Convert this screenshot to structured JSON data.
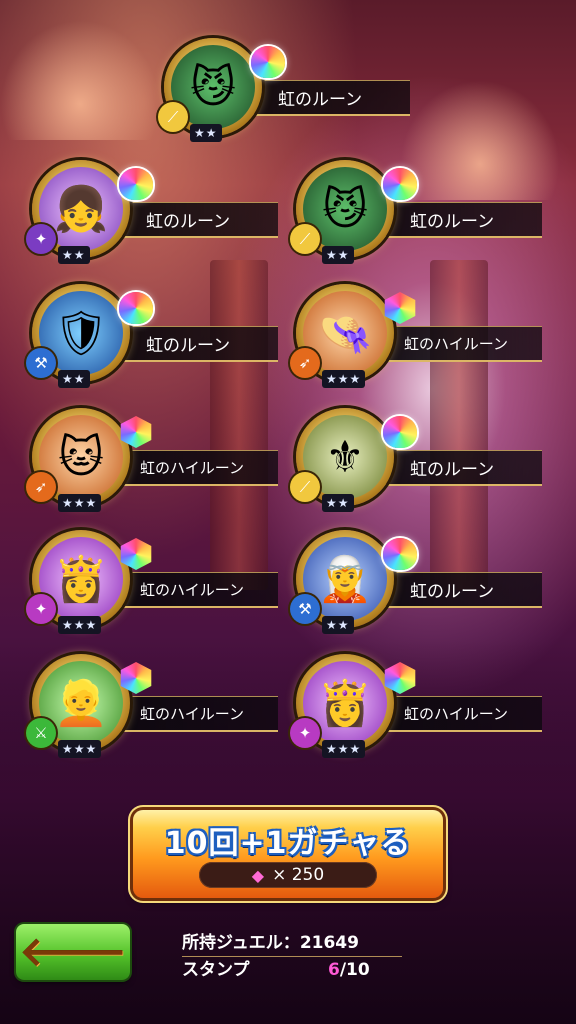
{
  "results": [
    {
      "id": "c1",
      "name": "虹のルーン",
      "stars": "★★",
      "portrait_icon": "cat-monster-icon",
      "element_icon": "slash-icon",
      "element_color": "#f1c83e",
      "rune": "round"
    },
    {
      "id": "c2",
      "name": "虹のルーン",
      "stars": "★★",
      "portrait_icon": "girl-blonde-icon",
      "element_icon": "staff-icon",
      "element_color": "#7b3cc2",
      "rune": "round"
    },
    {
      "id": "c3",
      "name": "虹のルーン",
      "stars": "★★",
      "portrait_icon": "cat-monster-icon",
      "element_icon": "slash-icon",
      "element_color": "#f1c83e",
      "rune": "round"
    },
    {
      "id": "c4",
      "name": "虹のルーン",
      "stars": "★★",
      "portrait_icon": "knight-black-icon",
      "element_icon": "axe-icon",
      "element_color": "#2d6ed2",
      "rune": "round"
    },
    {
      "id": "c5",
      "name": "虹のハイルーン",
      "stars": "★★★",
      "portrait_icon": "girl-pink-hat-icon",
      "element_icon": "bow-icon",
      "element_color": "#e46a1c",
      "rune": "hex"
    },
    {
      "id": "c6",
      "name": "虹のハイルーン",
      "stars": "★★★",
      "portrait_icon": "girl-catears-icon",
      "element_icon": "bow-icon",
      "element_color": "#e46a1c",
      "rune": "hex"
    },
    {
      "id": "c7",
      "name": "虹のルーン",
      "stars": "★★",
      "portrait_icon": "knight-gold-icon",
      "element_icon": "slash-icon",
      "element_color": "#f1c83e",
      "rune": "round"
    },
    {
      "id": "c8",
      "name": "虹のハイルーン",
      "stars": "★★★",
      "portrait_icon": "girl-crown-icon",
      "element_icon": "staff-icon",
      "element_color": "#b83ac2",
      "rune": "hex"
    },
    {
      "id": "c9",
      "name": "虹のルーン",
      "stars": "★★",
      "portrait_icon": "girl-silver-icon",
      "element_icon": "axe-icon",
      "element_color": "#2d6ed2",
      "rune": "round"
    },
    {
      "id": "c10",
      "name": "虹のハイルーン",
      "stars": "★★★",
      "portrait_icon": "girl-yellow-hat-icon",
      "element_icon": "sword-icon",
      "element_color": "#3cb83a",
      "rune": "hex"
    },
    {
      "id": "c11",
      "name": "虹のハイルーン",
      "stars": "★★★",
      "portrait_icon": "girl-crown-icon",
      "element_icon": "staff-icon",
      "element_color": "#b83ac2",
      "rune": "hex"
    }
  ],
  "gacha": {
    "title": "10回+1ガチャる",
    "currency_icon": "gem-icon",
    "cost": "× 250"
  },
  "back_button": {
    "icon": "left-arrow-icon"
  },
  "wallet": {
    "jewel_label": "所持ジュエル：",
    "jewel_value": "21649",
    "stamp_label": "スタンプ",
    "stamp_current": "6",
    "stamp_total": "/10"
  }
}
